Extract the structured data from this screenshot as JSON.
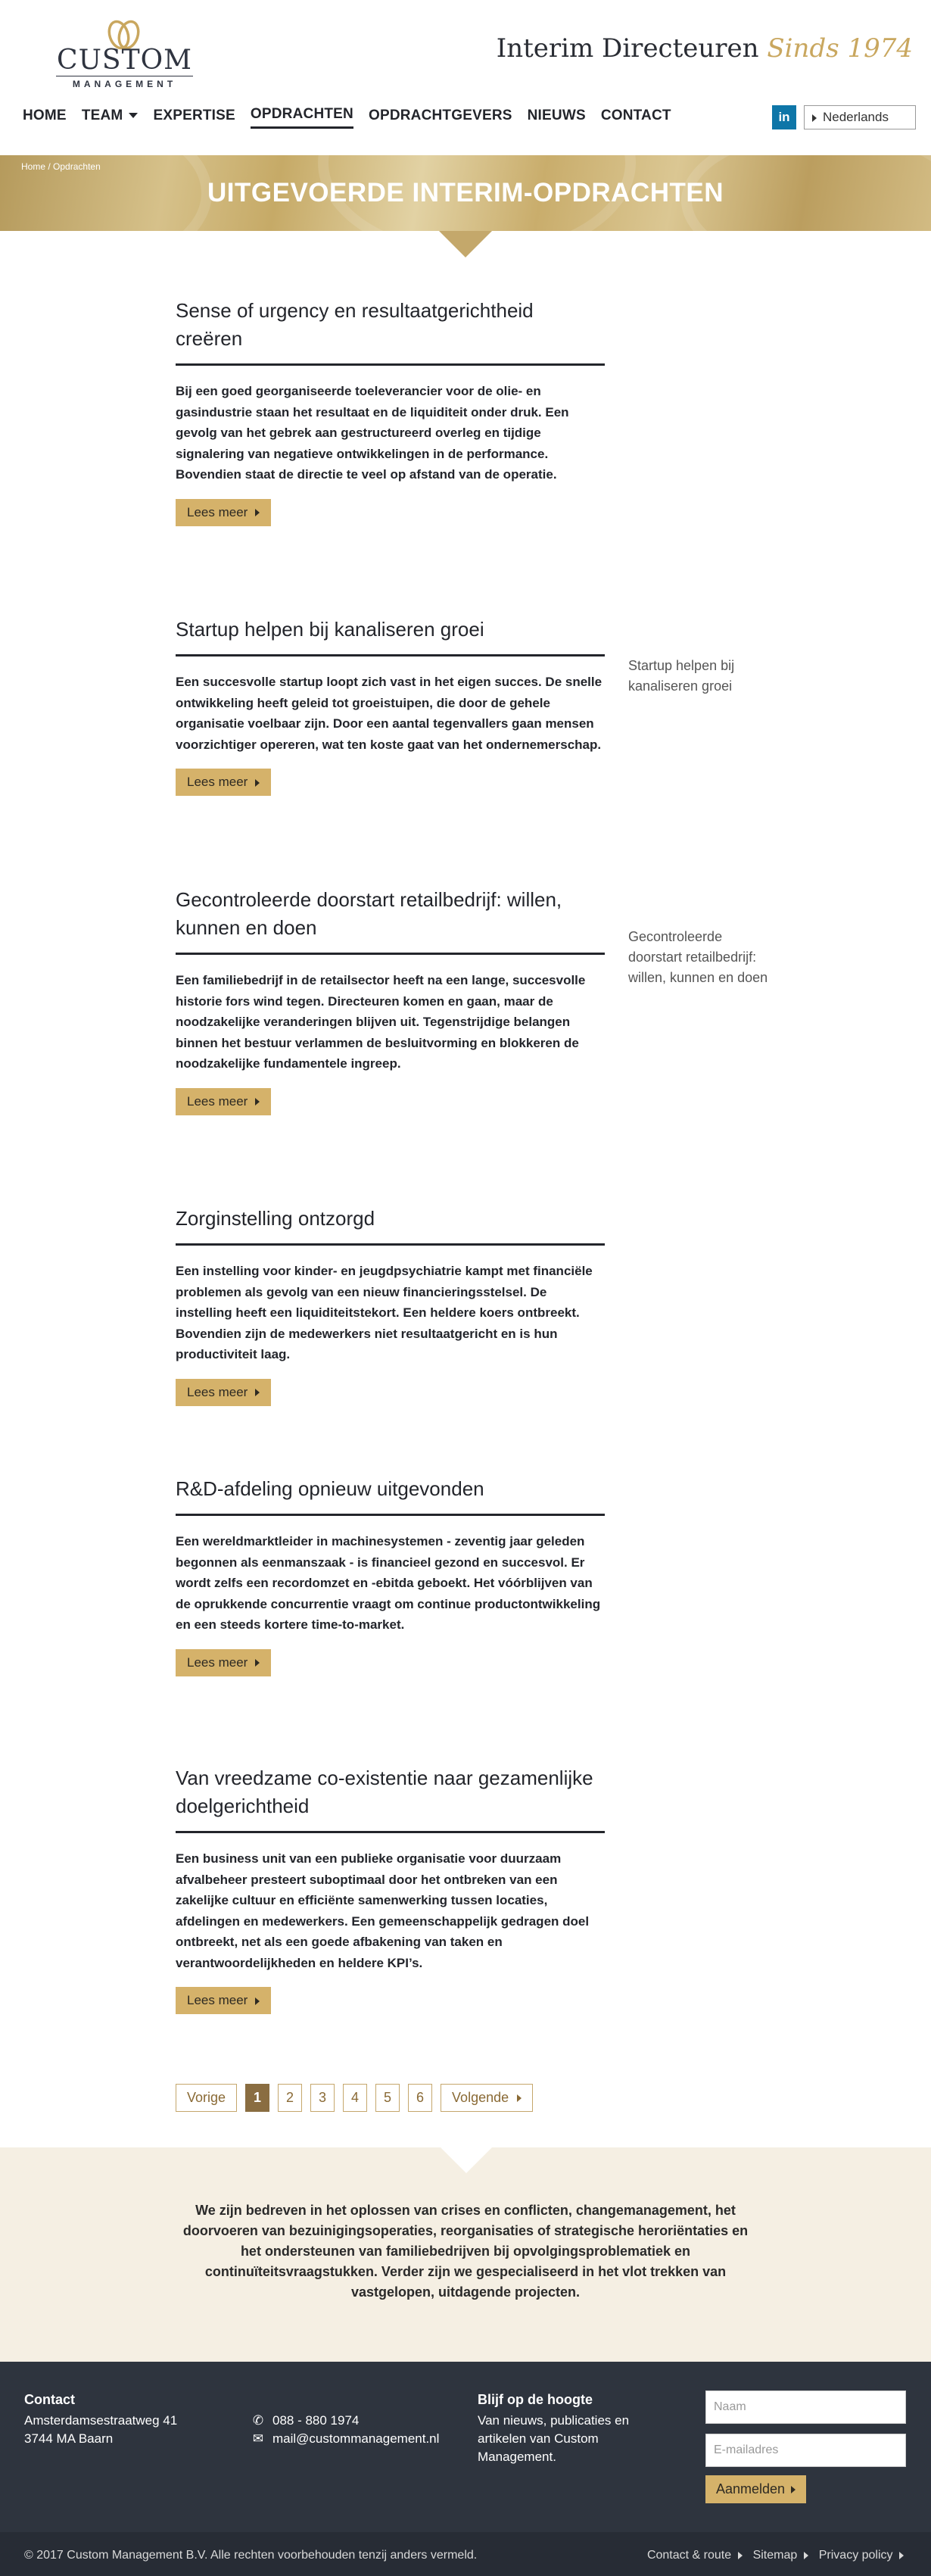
{
  "header": {
    "logo_main": "CUSTOM",
    "logo_sub": "MANAGEMENT",
    "tagline_part1": "Interim Directeuren",
    "tagline_part2": "Sinds 1974",
    "nav": [
      {
        "label": "HOME"
      },
      {
        "label": "TEAM"
      },
      {
        "label": "EXPERTISE"
      },
      {
        "label": "OPDRACHTEN"
      },
      {
        "label": "OPDRACHTGEVERS"
      },
      {
        "label": "NIEUWS"
      },
      {
        "label": "CONTACT"
      }
    ],
    "linkedin_label": "in",
    "language": "Nederlands"
  },
  "banner": {
    "breadcrumb_home": "Home",
    "breadcrumb_sep": "/",
    "breadcrumb_current": "Opdrachten",
    "title": "UITGEVOERDE INTERIM-OPDRACHTEN"
  },
  "articles": [
    {
      "title": "Sense of urgency en resultaatgerichtheid creëren",
      "text": "Bij een goed georganiseerde toeleverancier voor de olie- en gasindustrie staan het resultaat en de liquiditeit onder druk. Een gevolg van het gebrek aan gestructureerd overleg en tijdige signalering van negatieve ontwikkelingen in de performance. Bovendien staat de directie te veel op afstand van de operatie.",
      "button": "Lees meer"
    },
    {
      "title": "Startup helpen bij kanaliseren groei",
      "text": "Een succesvolle startup loopt zich vast in het eigen succes. De snelle ontwikkeling heeft geleid tot groeistuipen, die door de gehele organisatie voelbaar zijn. Door een aantal tegenvallers gaan mensen voorzichtiger opereren, wat ten koste gaat van het ondernemerschap.",
      "button": "Lees meer",
      "side": "Startup helpen bij kanaliseren groei"
    },
    {
      "title": "Gecontroleerde doorstart retailbedrijf: willen, kunnen en doen",
      "text": "Een familiebedrijf in de retailsector heeft na een lange, succesvolle historie fors wind tegen. Directeuren komen en gaan, maar de noodzakelijke veranderingen blijven uit. Tegenstrijdige belangen binnen het bestuur verlammen de besluitvorming en blokkeren de noodzakelijke  fundamentele ingreep.",
      "button": "Lees meer",
      "side": "Gecontroleerde doorstart retailbedrijf: willen, kunnen en doen"
    },
    {
      "title": "Zorginstelling ontzorgd",
      "text": "Een instelling voor kinder- en jeugdpsychiatrie kampt met financiële problemen als gevolg van een nieuw financieringsstelsel. De instelling heeft een liquiditeitstekort. Een heldere koers ontbreekt. Bovendien zijn de medewerkers niet resultaatgericht en is hun productiviteit laag.",
      "button": "Lees meer"
    },
    {
      "title": "R&D-afdeling opnieuw uitgevonden",
      "text": "Een wereldmarktleider in machinesystemen - zeventig jaar geleden begonnen als eenmanszaak - is financieel gezond en succesvol. Er wordt zelfs een recordomzet en -ebitda geboekt. Het vóórblijven van de oprukkende concurrentie vraagt om continue productontwikkeling en een steeds kortere time-to-market.",
      "button": "Lees meer"
    },
    {
      "title": "Van vreedzame co-existentie naar gezamenlijke doelgerichtheid",
      "text": "Een business unit van een publieke organisatie voor duurzaam afvalbeheer presteert suboptimaal door het ontbreken van een zakelijke cultuur en efficiënte samenwerking tussen locaties, afdelingen en medewerkers. Een gemeenschappelijk gedragen doel ontbreekt, net als een goede afbakening van taken en verantwoordelijkheden en heldere KPI’s.",
      "button": "Lees meer"
    }
  ],
  "pagination": {
    "prev": "Vorige",
    "pages": [
      "1",
      "2",
      "3",
      "4",
      "5",
      "6"
    ],
    "current": "1",
    "next": "Volgende"
  },
  "mission": {
    "text": "We zijn bedreven in het oplossen van crises en conflicten, changemanagement, het doorvoeren van bezuinigingsoperaties, reorganisaties of strategische heroriëntaties en het ondersteunen van familiebedrijven bij opvolgingsproblematiek en continuïteitsvraagstukken. Verder zijn we gespecialiseerd in het vlot trekken van vastgelopen, uitdagende projecten."
  },
  "footer": {
    "contact_heading": "Contact",
    "address_line1": "Amsterdamsestraatweg 41",
    "address_line2": "3744 MA Baarn",
    "phone": "088 - 880 1974",
    "email": "mail@custommanagement.nl",
    "newsletter_heading": "Blijf op de hoogte",
    "newsletter_text": "Van nieuws, publicaties en artikelen van Custom Management.",
    "name_placeholder": "Naam",
    "email_placeholder": "E-mailadres",
    "submit": "Aanmelden"
  },
  "bottom": {
    "copyright": "© 2017 Custom Management B.V. Alle rechten voorbehouden tenzij anders vermeld.",
    "links": [
      "Contact & route",
      "Sitemap",
      "Privacy policy"
    ]
  },
  "colors": {
    "gold": "#d5b26a",
    "dark": "#23252b",
    "footer": "#2e343e",
    "mission_bg": "#f5efe3"
  }
}
